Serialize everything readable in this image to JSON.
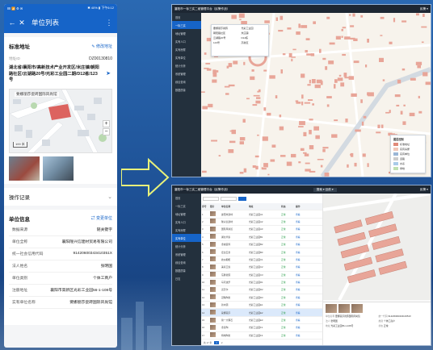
{
  "phone": {
    "status_left": "ⅠⅢ 📶 ⚙ ✉",
    "status_right": "✱ 40% ▮ 下午6:12",
    "title": "单位列表",
    "address_section": {
      "title": "标准地址",
      "action": "修改地址",
      "code_label": "地址ID",
      "code_value": "DZ00130810",
      "address": "湖北省/襄阳市/高新技术产业开发区/米庄镇/朝阳路社区/云湖路20号/光彩工业园二期/D12栋/123号",
      "map_label": "要娜丽莎瓷砖国际风尚馆",
      "scale": "100 米",
      "zoom_in": "+",
      "zoom_out": "−"
    },
    "records": {
      "title": "操作记录",
      "chevron": "⌄"
    },
    "unit_info": {
      "title": "单位信息",
      "action": "变更单位",
      "fields": [
        {
          "k": "数据来源",
          "v": "随关键字"
        },
        {
          "k": "单位全称",
          "v": "襄阳隆兴信建材贸易有限公司"
        },
        {
          "k": "统一社会信用代码",
          "v": "91420600343410351X"
        },
        {
          "k": "法人姓名",
          "v": "张明国"
        },
        {
          "k": "单位类别",
          "v": "个体工商户"
        },
        {
          "k": "注册地址",
          "v": "襄阳市高新区光彩工业园56-1-108号"
        },
        {
          "k": "实有单位名称",
          "v": "要娜丽莎瓷砖国际风尚馆"
        }
      ]
    }
  },
  "desktop_top": {
    "app_title": "襄阳市一标三实二维管理平台（民警作战）",
    "user": "民警 ▾",
    "menu": [
      "首页",
      "一标三实",
      "地址管理",
      "实有人口",
      "实有房屋",
      "实有单位",
      "统计分析",
      "系统管理",
      "综合查询",
      "数据质量"
    ],
    "popup_rows": [
      "要娜丽莎瓷砖",
      "光彩工业园",
      "朝阳路社区",
      "米庄镇",
      "云湖路20号",
      "D12栋",
      "123号",
      "高新区"
    ],
    "legend_title": "图层控制",
    "legend": [
      {
        "label": "标准地址",
        "color": "#e08a7a"
      },
      {
        "label": "实有房屋",
        "color": "#f0c6b8"
      },
      {
        "label": "实有单位",
        "color": "#9ab6d6"
      },
      {
        "label": "道路",
        "color": "#cccccc"
      },
      {
        "label": "水系",
        "color": "#a9cbe8"
      },
      {
        "label": "绿地",
        "color": "#bfe0b0"
      }
    ]
  },
  "desktop_bottom": {
    "app_title": "襄阳市一标三实二维管理平台（民警作战）",
    "tab_label": "搜索 ▾ 目前 ▾",
    "user": "民警 ▾",
    "menu": [
      "首页",
      "一标三实",
      "地址管理",
      "实有人口",
      "实有房屋",
      "实有单位",
      "统计分析",
      "系统管理",
      "综合查询",
      "数据质量",
      "日志"
    ],
    "table_header": [
      "序号",
      "照片",
      "单位名称",
      "地址",
      "状态",
      "操作"
    ],
    "rows": [
      [
        "1",
        "襄阳市建材",
        "光彩工业园A1",
        "正常"
      ],
      [
        "2",
        "隆兴信建材",
        "光彩工业园A2",
        "正常"
      ],
      [
        "3",
        "国际风尚馆",
        "光彩工业园A3",
        "正常"
      ],
      [
        "4",
        "湖北华泰",
        "光彩工业园B1",
        "正常"
      ],
      [
        "5",
        "金诚装饰",
        "光彩工业园B2",
        "正常"
      ],
      [
        "6",
        "宏达五金",
        "光彩工业园B3",
        "正常"
      ],
      [
        "7",
        "欧派橱柜",
        "光彩工业园C1",
        "正常"
      ],
      [
        "8",
        "美家卫浴",
        "光彩工业园C2",
        "正常"
      ],
      [
        "9",
        "东鹏瓷砖",
        "光彩工业园C3",
        "正常"
      ],
      [
        "10",
        "马可波罗",
        "光彩工业园D1",
        "正常"
      ],
      [
        "11",
        "诺贝尔",
        "光彩工业园D2",
        "正常"
      ],
      [
        "12",
        "冠珠陶瓷",
        "光彩工业园D3",
        "正常"
      ],
      [
        "13",
        "新中源",
        "光彩工业园E1",
        "正常"
      ],
      [
        "14",
        "蒙娜丽莎",
        "光彩工业园E2",
        "正常"
      ],
      [
        "15",
        "简一大理石",
        "光彩工业园E3",
        "正常"
      ],
      [
        "16",
        "金意陶",
        "光彩工业园F1",
        "正常"
      ],
      [
        "17",
        "特地陶瓷",
        "光彩工业园F2",
        "正常"
      ]
    ],
    "pager": "共 17 条",
    "detail": {
      "fields": [
        {
          "k": "单位名称",
          "v": "要娜丽莎瓷砖国际风尚馆"
        },
        {
          "k": "统一代码",
          "v": "91420600343410351X"
        },
        {
          "k": "法人",
          "v": "张明国"
        },
        {
          "k": "类别",
          "v": "个体工商户"
        },
        {
          "k": "地址",
          "v": "光彩工业园56-1-108号"
        },
        {
          "k": "状态",
          "v": "正常"
        }
      ]
    }
  }
}
